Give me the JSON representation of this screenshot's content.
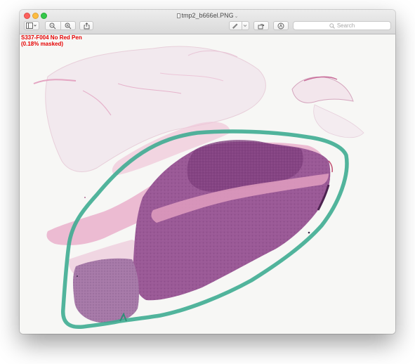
{
  "window": {
    "title": "tmp2_b666el.PNG"
  },
  "toolbar": {
    "sidebar_icon": "sidebar-icon",
    "zoom_out_icon": "zoom-out-icon",
    "zoom_in_icon": "zoom-in-icon",
    "share_icon": "share-icon",
    "markup_pen_icon": "pen-icon",
    "rotate_icon": "rotate-icon",
    "annotate_icon": "markup-icon"
  },
  "search": {
    "placeholder": "Search"
  },
  "overlay": {
    "line1": "S337-F004 No Red Pen",
    "line2": "(0.18% masked)"
  },
  "colors": {
    "pen_outline": "#3aab8f",
    "tissue_dark": "#8b4a86",
    "tissue_light": "#e7a9c6",
    "label_red": "#e60000"
  }
}
